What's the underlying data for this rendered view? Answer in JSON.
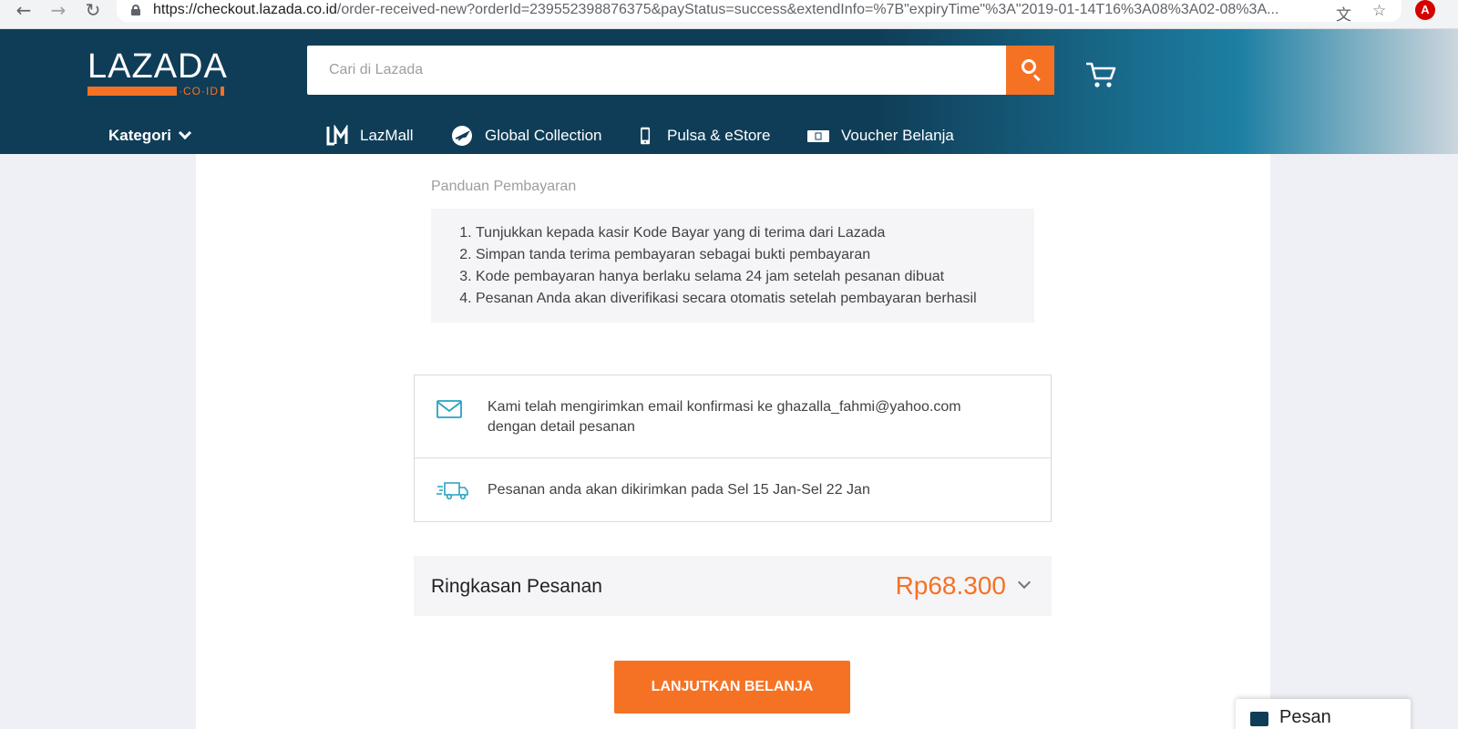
{
  "browser": {
    "url_host": "https://checkout.lazada.co.id",
    "url_path": "/order-received-new?orderId=239552398876375&payStatus=success&extendInfo=%7B\"expiryTime\"%3A\"2019-01-14T16%3A08%3A02-08%3A..."
  },
  "header": {
    "logo_text": "LAZADA",
    "logo_tld": "·CO·ID",
    "search_placeholder": "Cari di Lazada",
    "nav": {
      "kategori": "Kategori",
      "links": [
        {
          "label": "LazMall",
          "icon": "lazmall-icon"
        },
        {
          "label": "Global Collection",
          "icon": "plane-icon"
        },
        {
          "label": "Pulsa & eStore",
          "icon": "phone-icon"
        },
        {
          "label": "Voucher Belanja",
          "icon": "voucher-icon"
        }
      ]
    }
  },
  "guide": {
    "title": "Panduan Pembayaran",
    "steps": [
      "Tunjukkan kepada kasir Kode Bayar yang di terima dari Lazada",
      "Simpan tanda terima pembayaran sebagai bukti pembayaran",
      "Kode pembayaran hanya berlaku selama 24 jam setelah pesanan dibuat",
      "Pesanan Anda akan diverifikasi secara otomatis setelah pembayaran berhasil"
    ]
  },
  "info": {
    "email_line1": "Kami telah mengirimkan email konfirmasi ke ghazalla_fahmi@yahoo.com",
    "email_line2": "dengan detail pesanan",
    "delivery": "Pesanan anda akan dikirimkan pada Sel 15 Jan-Sel 22 Jan"
  },
  "summary": {
    "label": "Ringkasan Pesanan",
    "amount": "Rp68.300"
  },
  "cta": "LANJUTKAN BELANJA",
  "chat": "Pesan",
  "colors": {
    "brand_navy": "#0f3d57",
    "accent_orange": "#f57224"
  }
}
